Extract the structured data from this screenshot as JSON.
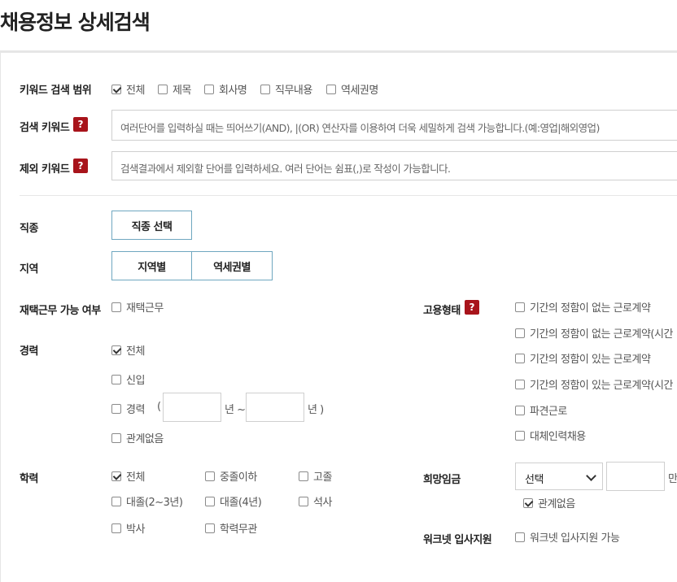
{
  "page_title": "채용정보 상세검색",
  "keyword_scope": {
    "label": "키워드 검색 범위",
    "options": [
      {
        "label": "전체",
        "checked": true
      },
      {
        "label": "제목",
        "checked": false
      },
      {
        "label": "회사명",
        "checked": false
      },
      {
        "label": "직무내용",
        "checked": false
      },
      {
        "label": "역세권명",
        "checked": false
      }
    ]
  },
  "search_keyword": {
    "label": "검색 키워드",
    "help": "?",
    "placeholder": "여러단어를 입력하실 때는 띄어쓰기(AND), |(OR) 연산자를 이용하여 더욱 세밀하게 검색 가능합니다.(예:영업|해외영업)"
  },
  "exclude_keyword": {
    "label": "제외 키워드",
    "help": "?",
    "placeholder": "검색결과에서 제외할 단어를 입력하세요. 여러 단어는 쉼표(,)로 작성이 가능합니다."
  },
  "job_type": {
    "label": "직종",
    "button": "직종 선택"
  },
  "region": {
    "label": "지역",
    "buttons": [
      "지역별",
      "역세권별"
    ]
  },
  "remote": {
    "label": "재택근무 가능 여부",
    "option": "재택근무",
    "checked": false
  },
  "career": {
    "label": "경력",
    "all": "전체",
    "all_checked": true,
    "new": "신입",
    "new_checked": false,
    "exp": "경력",
    "exp_checked": false,
    "paren_open": "(",
    "year1": "년 ~",
    "year2": "년 )",
    "any": "관계없음",
    "any_checked": false
  },
  "education": {
    "label": "학력",
    "options": [
      {
        "label": "전체",
        "checked": true
      },
      {
        "label": "중졸이하",
        "checked": false
      },
      {
        "label": "고졸",
        "checked": false
      },
      {
        "label": "대졸(2~3년)",
        "checked": false
      },
      {
        "label": "대졸(4년)",
        "checked": false
      },
      {
        "label": "석사",
        "checked": false
      },
      {
        "label": "박사",
        "checked": false
      },
      {
        "label": "학력무관",
        "checked": false
      }
    ]
  },
  "employment": {
    "label": "고용형태",
    "help": "?",
    "options": [
      {
        "label": "기간의 정함이 없는 근로계약",
        "checked": false
      },
      {
        "label": "기간의 정함이 없는 근로계약(시간",
        "checked": false
      },
      {
        "label": "기간의 정함이 있는 근로계약",
        "checked": false
      },
      {
        "label": "기간의 정함이 있는 근로계약(시간",
        "checked": false
      },
      {
        "label": "파견근로",
        "checked": false
      },
      {
        "label": "대체인력채용",
        "checked": false
      }
    ]
  },
  "salary": {
    "label": "희망임금",
    "select_value": "선택",
    "unit": "만",
    "any": "관계없음",
    "any_checked": true
  },
  "worknet": {
    "label": "워크넷 입사지원",
    "option": "워크넷 입사지원 가능",
    "checked": false
  }
}
